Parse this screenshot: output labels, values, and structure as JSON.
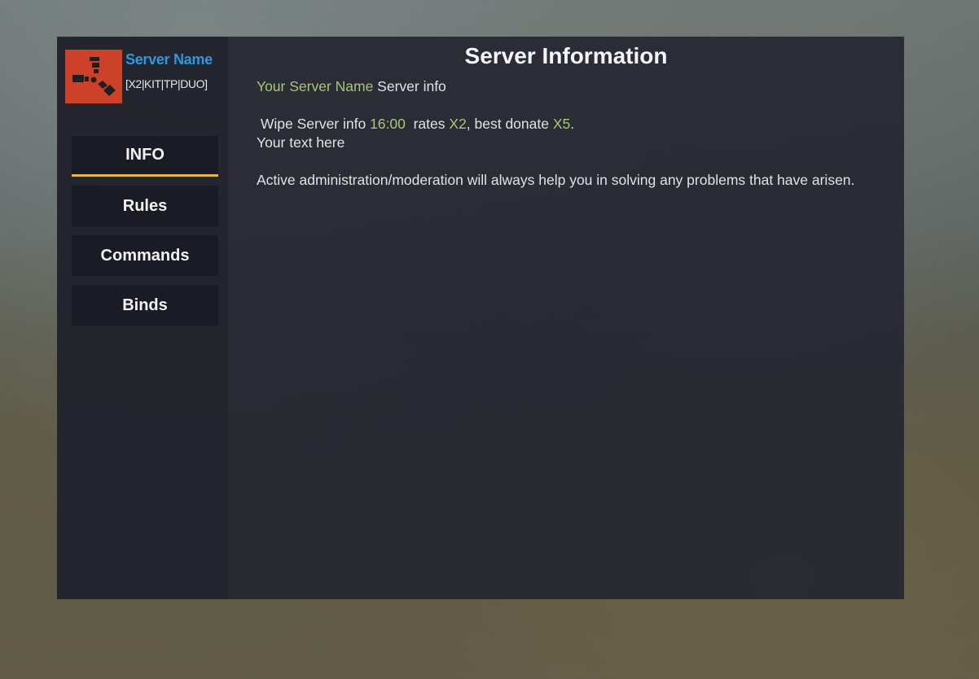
{
  "sidebar": {
    "logo_icon": "rust-logo-icon",
    "server_name": "Server Name",
    "server_tag": "[X2|KIT|TP|DUO]",
    "nav": [
      {
        "label": "INFO",
        "active": true
      },
      {
        "label": "Rules",
        "active": false
      },
      {
        "label": "Commands",
        "active": false
      },
      {
        "label": "Binds",
        "active": false
      }
    ]
  },
  "main": {
    "title": "Server Information",
    "line1_hl": "Your Server Name",
    "line1_rest": " Server info",
    "wipe_prefix": " Wipe Server info ",
    "wipe_time": "16:00",
    "rates_prefix": "  rates ",
    "rates_value": "X2",
    "donate_prefix": ", best donate ",
    "donate_value": "X5",
    "donate_suffix": ".",
    "custom_text": "Your text here",
    "admin_text": "Active administration/moderation will always help you in solving any problems that have arisen."
  },
  "colors": {
    "accent_blue": "#2e98dd",
    "highlight_green": "#a9c776",
    "active_underline": "#e8b44c",
    "logo_red": "#cd412b"
  }
}
